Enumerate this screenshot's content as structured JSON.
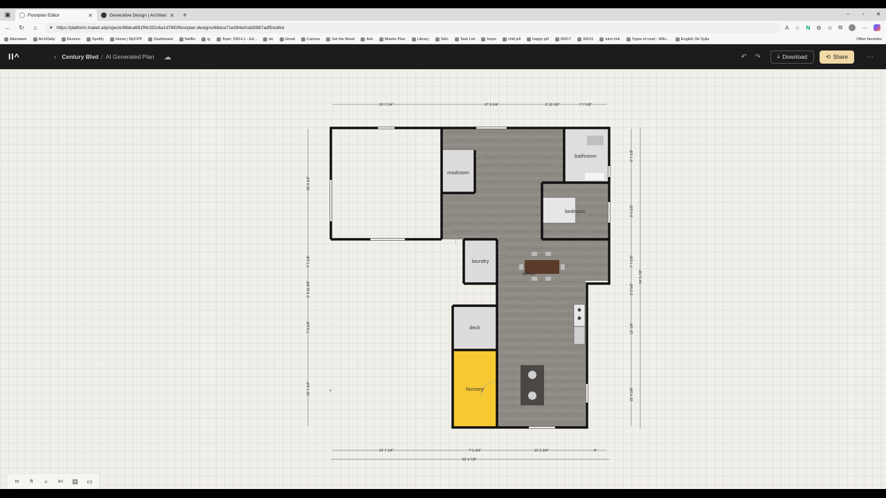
{
  "browser": {
    "tabs": [
      {
        "title": "Floorplan Editor",
        "active": true
      },
      {
        "title": "Generative Design | Architecture",
        "active": false
      }
    ],
    "new_tab": "+",
    "url": "https://platform.maket.ai/projects/68dca691ff4c5f2c6a1d76f0/floorplan-designs/68dca71e094e0cdd3987adf5/editor",
    "window_controls": [
      "–",
      "▫",
      "✕"
    ],
    "bookmarks": [
      "Alienware",
      "ArchDaily",
      "Dezeen",
      "Spotify",
      "Home | MyCPP",
      "Dashboard",
      "Netflix",
      "ig",
      "Topic: D814.1 - Ed...",
      "de",
      "Gmail",
      "Canvas",
      "Set the Mood",
      "Ask",
      "Master Plan",
      "Library",
      "Skin",
      "Task List",
      "Inspo",
      "chill pill",
      "happy pill",
      "90017",
      "90011",
      "tutor link",
      "Types of road - Wiki...",
      "English 3H Sylla"
    ],
    "other_favorites": "Other favorites"
  },
  "app": {
    "logo": "II^",
    "breadcrumb": {
      "project": "Century Blvd",
      "separator": "/",
      "plan": "AI Generated Plan"
    },
    "download_label": "Download",
    "share_label": "Share",
    "more": "···"
  },
  "plan": {
    "rooms": {
      "mudroom": "mudroom",
      "bathroom": "bathroom",
      "bedroom": "bedroom",
      "laundry": "laundry",
      "kitchen": "kitchen",
      "deck": "deck",
      "nursery": "Nursery"
    },
    "dimensions": {
      "top": [
        "19' 7 1/4\"",
        "17' 9 3/4\"",
        "3' 10 1/8\"",
        "7' 7 1/8\""
      ],
      "bottom_segments": [
        "19' 7 1/4\"",
        "7' 5 3/4\"",
        "15' 6 3/4\"",
        "4\""
      ],
      "bottom_total": "50' 5 7/8\"",
      "left": [
        "19' 6 1/4\"",
        "7' 7 1/8\"",
        "2' 4 11 5/8\"",
        "7' 8 1/8\"",
        "12' 7 1/4\""
      ],
      "right": [
        "9' 7 1/8\"",
        "9' 6 1/8\"",
        "7' 7 1/8\"",
        "2' 2 5/8\"",
        "12' 1/8\"",
        "11' 9 1/8\""
      ],
      "right_total": "54' 5 7/8\""
    },
    "colors": {
      "floor": "#8d8a83",
      "nursery": "#f7ca33",
      "wall": "#111111",
      "room_gray": "#dcdcdc"
    }
  },
  "toolbar": {
    "unit_m": "m",
    "unit_ft": "ft",
    "icons": [
      "search-icon",
      "tools-icon",
      "comment-icon",
      "furniture-icon"
    ]
  }
}
